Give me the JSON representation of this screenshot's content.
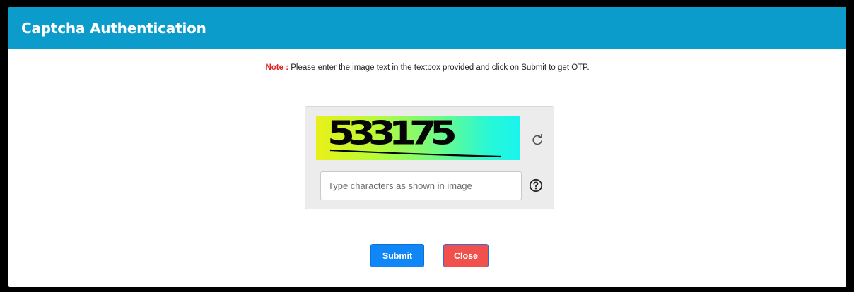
{
  "header": {
    "title": "Captcha Authentication"
  },
  "note": {
    "label": "Note :",
    "text": " Please enter the image text in the textbox provided and click on Submit to get OTP."
  },
  "captcha": {
    "image_text": "533175",
    "input_placeholder": "Type characters as shown in image",
    "input_value": "",
    "refresh_icon": "refresh-icon",
    "help_icon": "question-circle-icon"
  },
  "actions": {
    "submit_label": "Submit",
    "close_label": "Close"
  },
  "colors": {
    "header_bg": "#0c9ccb",
    "note_label": "#e02020",
    "submit_bg": "#1087f6",
    "close_bg": "#f2504d"
  }
}
